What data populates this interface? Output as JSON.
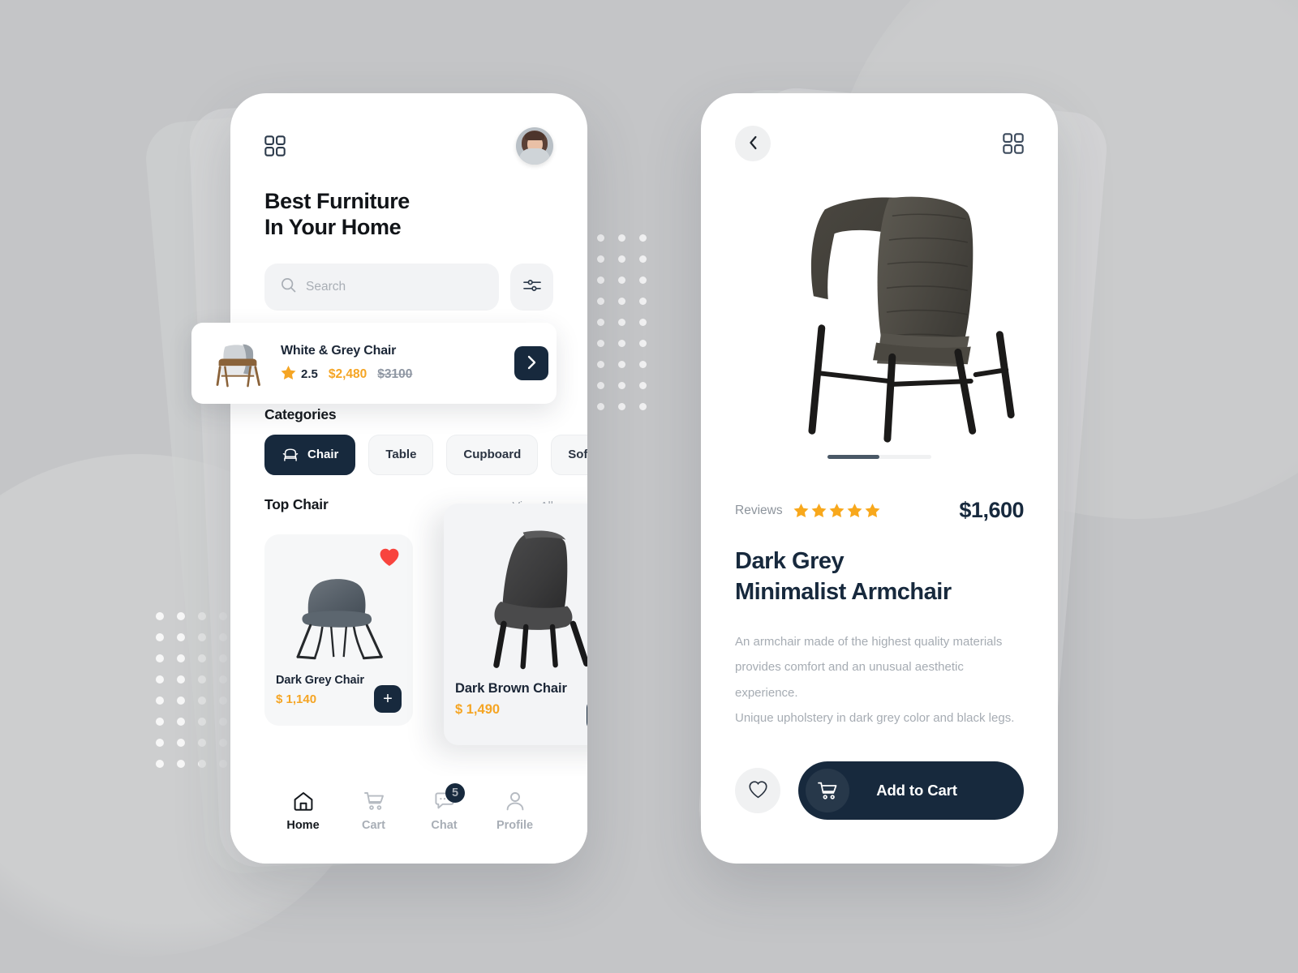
{
  "theme": {
    "background": "#c4c5c7",
    "navy": "#17293d",
    "amber": "#f5a524",
    "muted": "#a6acb3",
    "card": "#f6f7f8",
    "heart_red": "#f2ararr"
  },
  "home_screen": {
    "grid_icon": "grid-icon",
    "avatar": "user-avatar",
    "headline_line1": "Best Furniture",
    "headline_line2": "In Your Home",
    "search": {
      "icon": "search-icon",
      "placeholder": "Search",
      "value": "",
      "filter_icon": "filter-sliders-icon"
    },
    "featured": {
      "title": "White & Grey Chair",
      "rating": "2.5",
      "price": "$2,480",
      "old_price": "$3100",
      "next_icon": "chevron-right-icon",
      "image": "white-grey-armchair"
    },
    "categories_title": "Categories",
    "categories": [
      {
        "label": "Chair",
        "active": true,
        "icon": "armchair-icon"
      },
      {
        "label": "Table",
        "active": false
      },
      {
        "label": "Cupboard",
        "active": false
      },
      {
        "label": "Sofa",
        "active": false
      }
    ],
    "top_section": {
      "title": "Top Chair",
      "view_all": "View All"
    },
    "products": [
      {
        "name": "Dark Grey Chair",
        "price": "$ 1,140",
        "favorited": true,
        "add_label": "+",
        "image": "dark-grey-chair"
      },
      {
        "name": "Dark Brown Chair",
        "price": "$ 1,490",
        "favorited": false,
        "add_label": "+",
        "image": "dark-brown-chair"
      }
    ],
    "tabs": [
      {
        "label": "Home",
        "icon": "home-icon",
        "active": true,
        "badge": ""
      },
      {
        "label": "Cart",
        "icon": "cart-icon",
        "active": false,
        "badge": ""
      },
      {
        "label": "Chat",
        "icon": "chat-icon",
        "active": false,
        "badge": "5"
      },
      {
        "label": "Profile",
        "icon": "profile-icon",
        "active": false,
        "badge": ""
      }
    ]
  },
  "detail_screen": {
    "back_icon": "chevron-left-icon",
    "grid_icon": "grid-icon",
    "hero_image": "dark-grey-minimalist-armchair",
    "pager": {
      "total": 2,
      "current": 1
    },
    "reviews_label": "Reviews",
    "stars": 5,
    "price": "$1,600",
    "title_line1": "Dark Grey",
    "title_line2": "Minimalist Armchair",
    "description_lines": [
      "An armchair made of the highest quality materials",
      "provides comfort and an unusual aesthetic experience.",
      "Unique upholstery in dark grey color and black legs."
    ],
    "like_icon": "heart-outline-icon",
    "add_to_cart": {
      "label": "Add to Cart",
      "icon": "cart-icon"
    }
  }
}
